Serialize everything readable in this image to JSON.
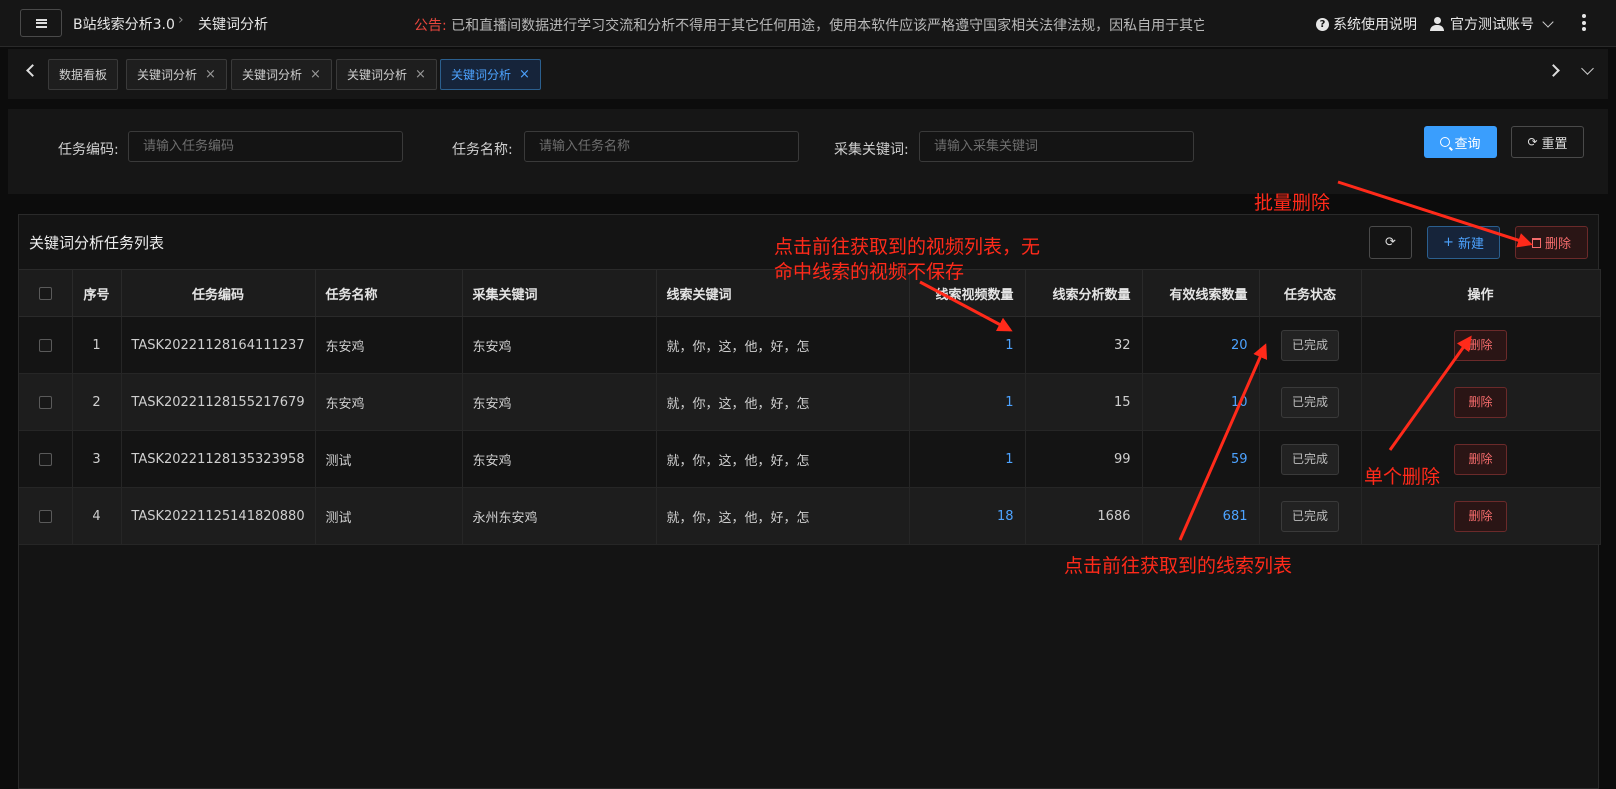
{
  "header": {
    "app_title": "B站线索分析3.0",
    "breadcrumb_current": "关键词分析",
    "notice_label": "公告:",
    "notice_text": "已和直播间数据进行学习交流和分析不得用于其它任何用途，使用本软件应该严格遵守国家相关法律法规，因私自用于其它",
    "help_label": "系统使用说明",
    "account_label": "官方测试账号"
  },
  "tabs": [
    {
      "label": "数据看板",
      "closable": false
    },
    {
      "label": "关键词分析",
      "closable": true
    },
    {
      "label": "关键词分析",
      "closable": true
    },
    {
      "label": "关键词分析",
      "closable": true
    },
    {
      "label": "关键词分析",
      "closable": true,
      "active": true
    }
  ],
  "search": {
    "task_code_label": "任务编码:",
    "task_code_placeholder": "请输入任务编码",
    "task_name_label": "任务名称:",
    "task_name_placeholder": "请输入任务名称",
    "keyword_label": "采集关键词:",
    "keyword_placeholder": "请输入采集关键词",
    "query_label": "查询",
    "reset_label": "重置"
  },
  "card": {
    "title": "关键词分析任务列表",
    "new_label": "新建",
    "delete_label": "删除"
  },
  "table": {
    "columns": [
      "序号",
      "任务编码",
      "任务名称",
      "采集关键词",
      "线索关键词",
      "线索视频数量",
      "线索分析数量",
      "有效线索数量",
      "任务状态",
      "操作"
    ],
    "rows": [
      {
        "index": "1",
        "code": "TASK20221128164111237",
        "name": "东安鸡",
        "keyword": "东安鸡",
        "clue_keywords": "就，你，这，他，好，怎",
        "video_count": "1",
        "analysis_count": "32",
        "valid_count": "20",
        "status": "已完成",
        "action": "删除"
      },
      {
        "index": "2",
        "code": "TASK20221128155217679",
        "name": "东安鸡",
        "keyword": "东安鸡",
        "clue_keywords": "就，你，这，他，好，怎",
        "video_count": "1",
        "analysis_count": "15",
        "valid_count": "10",
        "status": "已完成",
        "action": "删除"
      },
      {
        "index": "3",
        "code": "TASK20221128135323958",
        "name": "测试",
        "keyword": "东安鸡",
        "clue_keywords": "就，你，这，他，好，怎",
        "video_count": "1",
        "analysis_count": "99",
        "valid_count": "59",
        "status": "已完成",
        "action": "删除"
      },
      {
        "index": "4",
        "code": "TASK20221125141820880",
        "name": "测试",
        "keyword": "永州东安鸡",
        "clue_keywords": "就，你，这，他，好，怎",
        "video_count": "18",
        "analysis_count": "1686",
        "valid_count": "681",
        "status": "已完成",
        "action": "删除"
      }
    ]
  },
  "annotations": {
    "batch_delete": "批量删除",
    "video_list_line1": "点击前往获取到的视频列表，无",
    "video_list_line2": "命中线索的视频不保存",
    "single_delete": "单个删除",
    "clue_list": "点击前往获取到的线索列表"
  },
  "colors": {
    "accent": "#3a9efd",
    "danger": "#f56c6c",
    "annotation": "#ff2a1a"
  }
}
